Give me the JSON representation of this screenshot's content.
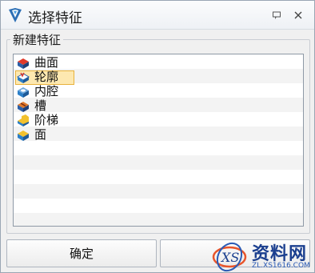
{
  "window": {
    "title": "选择特征"
  },
  "group": {
    "label": "新建特征"
  },
  "list": {
    "items": [
      {
        "label": "曲面",
        "icon": "surface-icon",
        "selected": false
      },
      {
        "label": "轮廓",
        "icon": "profile-icon",
        "selected": true
      },
      {
        "label": "内腔",
        "icon": "cavity-icon",
        "selected": false
      },
      {
        "label": "槽",
        "icon": "slot-icon",
        "selected": false
      },
      {
        "label": "阶梯",
        "icon": "step-icon",
        "selected": false
      },
      {
        "label": "面",
        "icon": "face-icon",
        "selected": false
      }
    ]
  },
  "buttons": {
    "ok_label": "确定",
    "cancel_label": ""
  },
  "watermark": {
    "brand": "资料网",
    "url": "ZL.XS1616.COM",
    "logo_text": "XS"
  },
  "colors": {
    "selection_fill": "#fde8b0",
    "selection_border": "#e8b23c",
    "stripe": "#f3f3f3",
    "watermark_blue": "#1b3f8f"
  }
}
